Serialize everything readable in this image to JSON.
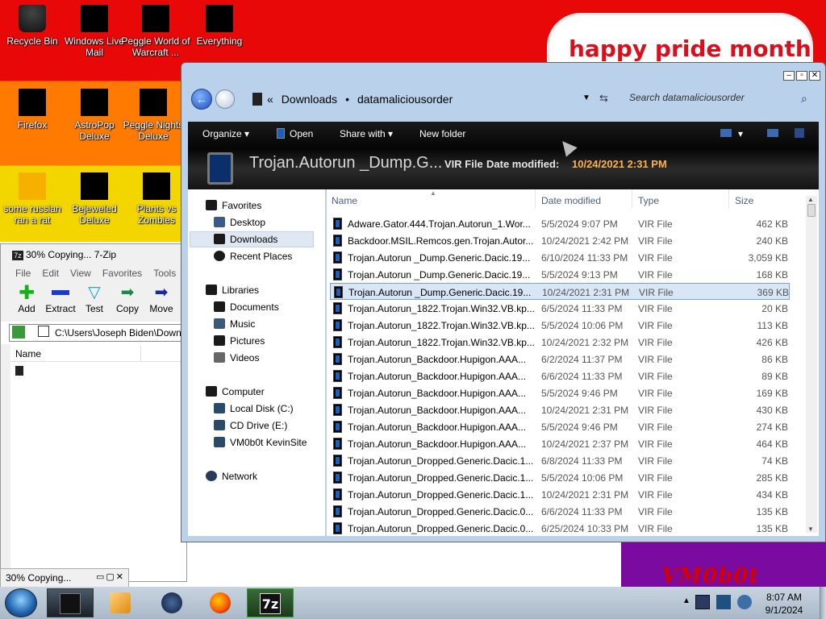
{
  "desktop": {
    "banner_text": "happy pride month",
    "wall_text": "VM0b0t",
    "icons": [
      {
        "label": "Recycle Bin"
      },
      {
        "label": "Windows Live Mail"
      },
      {
        "label": "Peggle World of Warcraft ..."
      },
      {
        "label": "Everything"
      },
      {
        "label": "Firefox"
      },
      {
        "label": "AstroPop Deluxe"
      },
      {
        "label": "Peggle Nights Deluxe"
      },
      {
        "label": "some russian ran a rat"
      },
      {
        "label": "Bejeweled Deluxe"
      },
      {
        "label": "Plants vs Zombies"
      }
    ]
  },
  "sevenzip": {
    "title": "30% Copying... 7-Zip",
    "menu": [
      "File",
      "Edit",
      "View",
      "Favorites",
      "Tools"
    ],
    "toolbar": [
      "Add",
      "Extract",
      "Test",
      "Copy",
      "Move"
    ],
    "path": "C:\\Users\\Joseph Biden\\Downl",
    "column_name": "Name",
    "mini_title": "30% Copying..."
  },
  "explorer": {
    "breadcrumb": [
      "Downloads",
      "datamaliciousorder"
    ],
    "search_placeholder": "Search datamaliciousorder",
    "commands": {
      "organize": "Organize",
      "open": "Open",
      "share": "Share with",
      "newfolder": "New folder"
    },
    "details": {
      "filename": "Trojan.Autorun _Dump.G...",
      "filetype": "VIR File",
      "date_label": "Date modified:",
      "date_value": "10/24/2021 2:31 PM"
    },
    "nav": {
      "favorites": "Favorites",
      "desktop": "Desktop",
      "downloads": "Downloads",
      "recent": "Recent Places",
      "libraries": "Libraries",
      "documents": "Documents",
      "music": "Music",
      "pictures": "Pictures",
      "videos": "Videos",
      "computer": "Computer",
      "localdisk": "Local Disk (C:)",
      "cddrive": "CD Drive (E:)",
      "vmsite": "VM0b0t KevinSite",
      "network": "Network"
    },
    "columns": {
      "name": "Name",
      "date": "Date modified",
      "type": "Type",
      "size": "Size"
    },
    "files": [
      {
        "name": "Adware.Gator.444.Trojan.Autorun_1.Wor...",
        "date": "5/5/2024 9:07 PM",
        "type": "VIR File",
        "size": "462 KB"
      },
      {
        "name": "Backdoor.MSIL.Remcos.gen.Trojan.Autor...",
        "date": "10/24/2021 2:42 PM",
        "type": "VIR File",
        "size": "240 KB"
      },
      {
        "name": "Trojan.Autorun _Dump.Generic.Dacic.19...",
        "date": "6/10/2024 11:33 PM",
        "type": "VIR File",
        "size": "3,059 KB"
      },
      {
        "name": "Trojan.Autorun _Dump.Generic.Dacic.19...",
        "date": "5/5/2024 9:13 PM",
        "type": "VIR File",
        "size": "168 KB"
      },
      {
        "name": "Trojan.Autorun _Dump.Generic.Dacic.19...",
        "date": "10/24/2021 2:31 PM",
        "type": "VIR File",
        "size": "369 KB"
      },
      {
        "name": "Trojan.Autorun_1822.Trojan.Win32.VB.kp...",
        "date": "6/5/2024 11:33 PM",
        "type": "VIR File",
        "size": "20 KB"
      },
      {
        "name": "Trojan.Autorun_1822.Trojan.Win32.VB.kp...",
        "date": "5/5/2024 10:06 PM",
        "type": "VIR File",
        "size": "113 KB"
      },
      {
        "name": "Trojan.Autorun_1822.Trojan.Win32.VB.kp...",
        "date": "10/24/2021 2:32 PM",
        "type": "VIR File",
        "size": "426 KB"
      },
      {
        "name": "Trojan.Autorun_Backdoor.Hupigon.AAA...",
        "date": "6/2/2024 11:37 PM",
        "type": "VIR File",
        "size": "86 KB"
      },
      {
        "name": "Trojan.Autorun_Backdoor.Hupigon.AAA...",
        "date": "6/6/2024 11:33 PM",
        "type": "VIR File",
        "size": "89 KB"
      },
      {
        "name": "Trojan.Autorun_Backdoor.Hupigon.AAA...",
        "date": "5/5/2024 9:46 PM",
        "type": "VIR File",
        "size": "169 KB"
      },
      {
        "name": "Trojan.Autorun_Backdoor.Hupigon.AAA...",
        "date": "10/24/2021 2:31 PM",
        "type": "VIR File",
        "size": "430 KB"
      },
      {
        "name": "Trojan.Autorun_Backdoor.Hupigon.AAA...",
        "date": "5/5/2024 9:46 PM",
        "type": "VIR File",
        "size": "274 KB"
      },
      {
        "name": "Trojan.Autorun_Backdoor.Hupigon.AAA...",
        "date": "10/24/2021 2:37 PM",
        "type": "VIR File",
        "size": "464 KB"
      },
      {
        "name": "Trojan.Autorun_Dropped.Generic.Dacic.1...",
        "date": "6/8/2024 11:33 PM",
        "type": "VIR File",
        "size": "74 KB"
      },
      {
        "name": "Trojan.Autorun_Dropped.Generic.Dacic.1...",
        "date": "5/5/2024 10:06 PM",
        "type": "VIR File",
        "size": "285 KB"
      },
      {
        "name": "Trojan.Autorun_Dropped.Generic.Dacic.1...",
        "date": "10/24/2021 2:31 PM",
        "type": "VIR File",
        "size": "434 KB"
      },
      {
        "name": "Trojan.Autorun_Dropped.Generic.Dacic.0...",
        "date": "6/6/2024 11:33 PM",
        "type": "VIR File",
        "size": "135 KB"
      },
      {
        "name": "Trojan.Autorun_Dropped.Generic.Dacic.0...",
        "date": "6/25/2024 10:33 PM",
        "type": "VIR File",
        "size": "135 KB"
      }
    ],
    "selected_row": 4
  },
  "taskbar": {
    "time": "8:07 AM",
    "date": "9/1/2024"
  }
}
